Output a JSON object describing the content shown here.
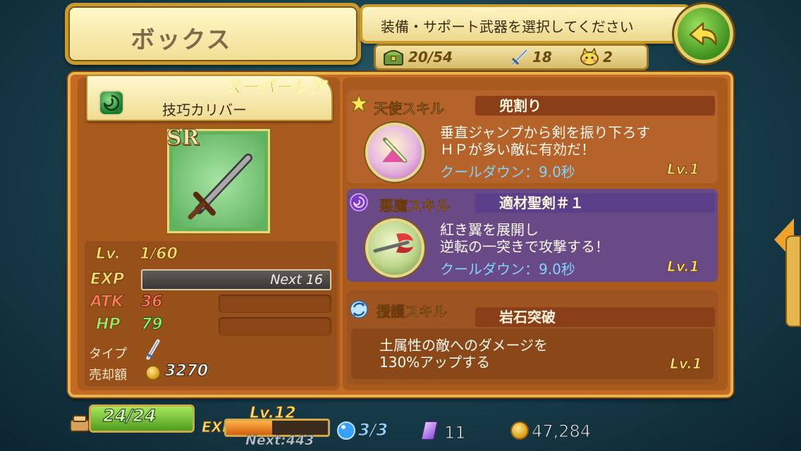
{
  "screen": {
    "title": "ボックス",
    "instruction": "装備・サポート武器を選択してください",
    "box_count": "20/54",
    "weapon_count": "18",
    "support_count": "2"
  },
  "weapon": {
    "rarity_label": "スーパーレア",
    "rarity_badge": "SR",
    "name": "技巧カリバー",
    "lv_label": "Lv.",
    "level": "1/60",
    "exp_label": "EXP",
    "exp_next": "Next 16",
    "atk_label": "ATK",
    "atk": "36",
    "hp_label": "HP",
    "hp": "79",
    "type_label": "タイプ",
    "sell_label": "売却額",
    "sell_price": "3270"
  },
  "skills": {
    "angel": {
      "type": "天使スキル",
      "name": "兜割り",
      "desc_line1": "垂直ジャンプから剣を振り下ろす",
      "desc_line2": "ＨＰが多い敵に有効だ！",
      "cooldown": "クールダウン：9.0秒",
      "level": "Lv.1"
    },
    "demon": {
      "type": "悪魔スキル",
      "name": "適材聖剣＃１",
      "desc_line1": "紅き翼を展開し",
      "desc_line2": "逆転の一突きで攻撃する！",
      "cooldown": "クールダウン：9.0秒",
      "level": "Lv.1"
    },
    "support": {
      "type": "援護スキル",
      "name": "岩石突破",
      "desc_line1": "土属性の敵へのダメージを",
      "desc_line2": "130%アップする",
      "level": "Lv.1"
    }
  },
  "player": {
    "stamina": "24/24",
    "stamina_fraction": 1.0,
    "exp_label": "EXP",
    "level": "Lv.12",
    "exp_fraction": 0.45,
    "next_exp": "Next:443",
    "orbs": "3/3",
    "crystals": "11",
    "coins": "47,284"
  },
  "colors": {
    "panel": "#c46a23",
    "banner": "#fff6c4",
    "angel_bar": "#8a3f18",
    "demon_bar": "#5a3f8a",
    "cooldown": "#7ed3ff"
  }
}
